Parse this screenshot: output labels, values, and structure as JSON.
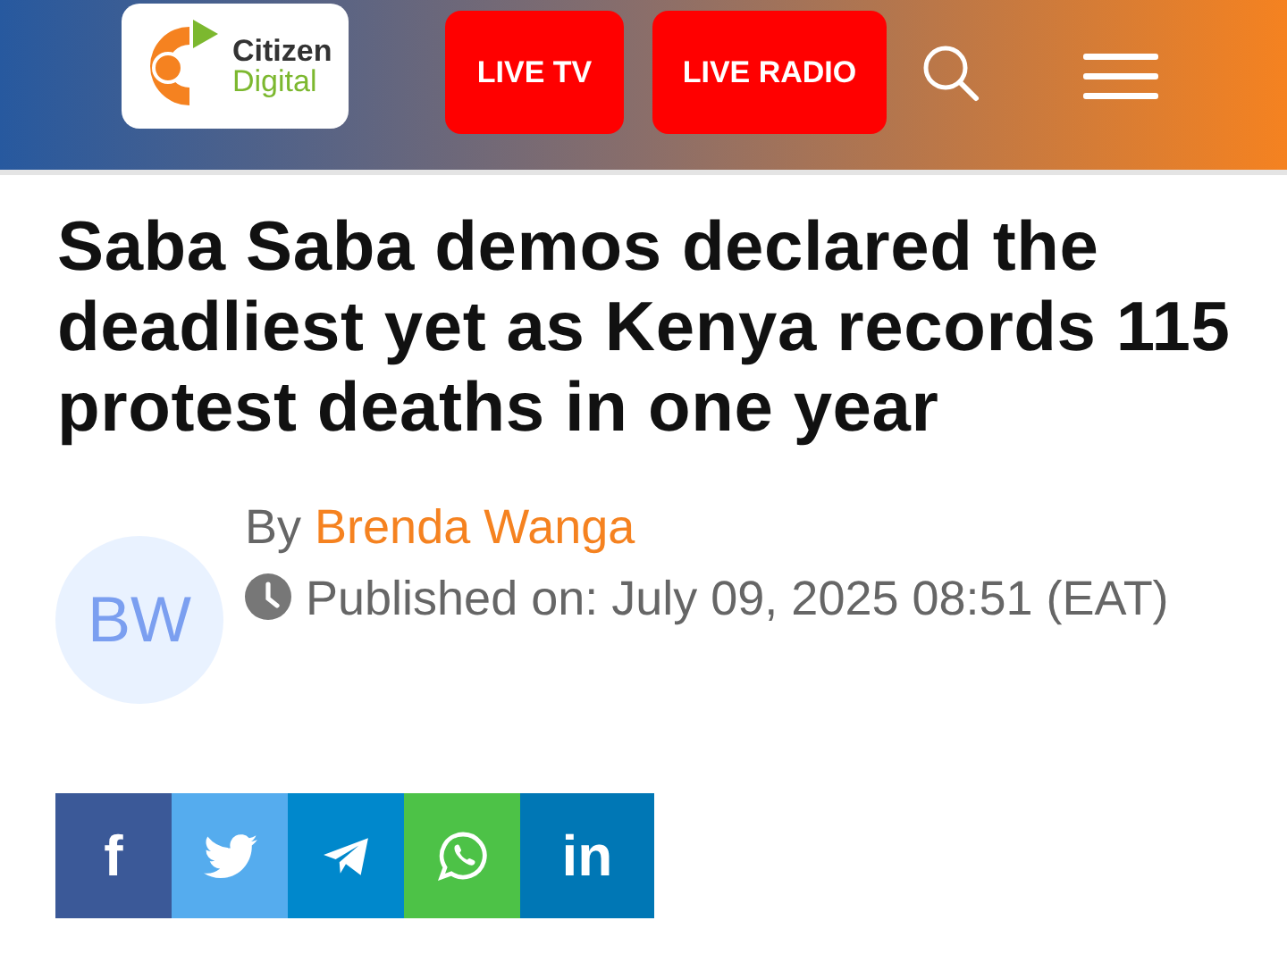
{
  "header": {
    "logo": {
      "line_1": "Citizen",
      "line_2": "Digital"
    },
    "buttons": [
      "LIVE TV",
      "LIVE RADIO"
    ]
  },
  "article": {
    "title": "Saba Saba demos declared the deadliest yet as Kenya records 115 protest deaths in one year",
    "author": {
      "initials": "BW",
      "by": "By",
      "name": "Brenda Wanga"
    },
    "published": "Published on: July 09, 2025 08:51 (EAT)"
  },
  "share": [
    {
      "kind": "letter",
      "text": "f",
      "color": "#3b5998"
    },
    {
      "kind": "bird",
      "color": "#55acee"
    },
    {
      "kind": "plane",
      "color": "#0088cc"
    },
    {
      "kind": "chat",
      "color": "#4dc247"
    },
    {
      "kind": "letter",
      "text": "in",
      "color": "#0077b5"
    }
  ]
}
